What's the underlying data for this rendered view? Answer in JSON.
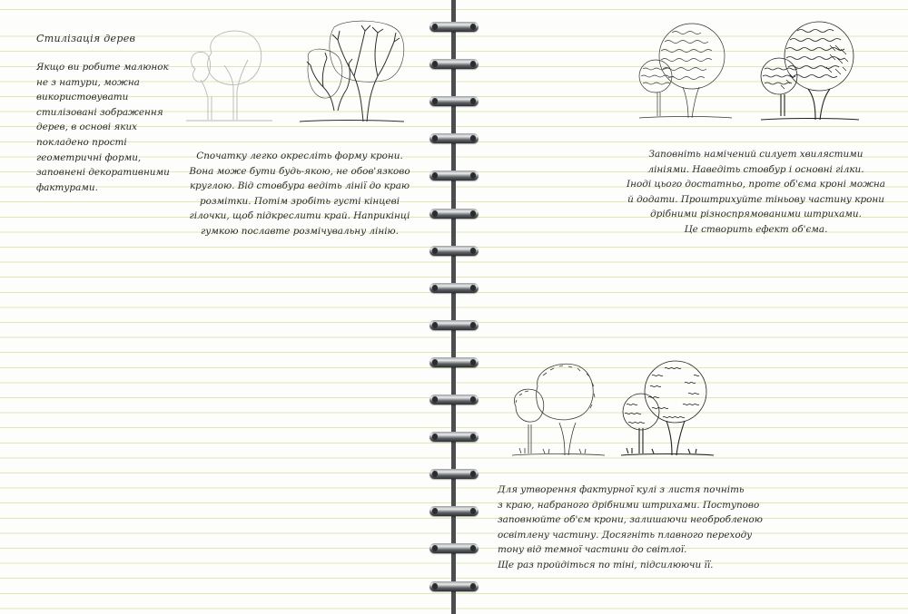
{
  "left_page": {
    "title": "Стилізація дерев",
    "intro_lines": [
      "Якщо ви робите малюнок",
      "не з натури, можна",
      "використовувати",
      "стилізовані зображення",
      "дерев, в основі яких",
      "покладено прості",
      "геометричні форми,",
      "заповнені декоративними",
      "фактурами."
    ],
    "step1_lines": [
      "Спочатку легко окресліть форму крони.",
      "Вона може бути будь-якою, не обов'язково",
      "круглою. Від стовбура ведіть лінії до краю",
      "розмітки. Потім зробіть густі кінцеві",
      "гілочки, щоб підкреслити край. Наприкінці",
      "гумкою пославте розмічувальну лінію."
    ]
  },
  "right_page": {
    "step2_lines": [
      "Заповніть намічений силует хвилястими",
      "лініями. Наведіть стовбур і основні гілки.",
      "Іноді цього достатньо, проте об'єма кроні можна",
      "й додати. Проштрихуйте тіньову частину крони",
      "дрібними різноспрямованими штрихами.",
      "Це створить ефект об'єма."
    ],
    "step3_lines": [
      "Для утворення фактурної кулі з листя почніть",
      "з краю, набраного дрібними штрихами. Поступово",
      "заповнюйте об'єм крони, залишаючи необробленою",
      "освітлену частину. Досягніть плавного переходу",
      "тону від темної частини до світлої.",
      "Ще раз пройдіться по тіні, підсилюючи її."
    ]
  },
  "colors": {
    "ruling": "#dfe7b5",
    "paper": "#fdfdfb",
    "ink": "#2a2a2a",
    "spine": "#4b4d50"
  },
  "illustrations": [
    "tree-sketch-outline-icon",
    "tree-sketch-branches-icon",
    "tree-wavy-texture-icon",
    "tree-wavy-shaded-icon",
    "tree-ball-outline-icon",
    "tree-ball-textured-icon"
  ]
}
